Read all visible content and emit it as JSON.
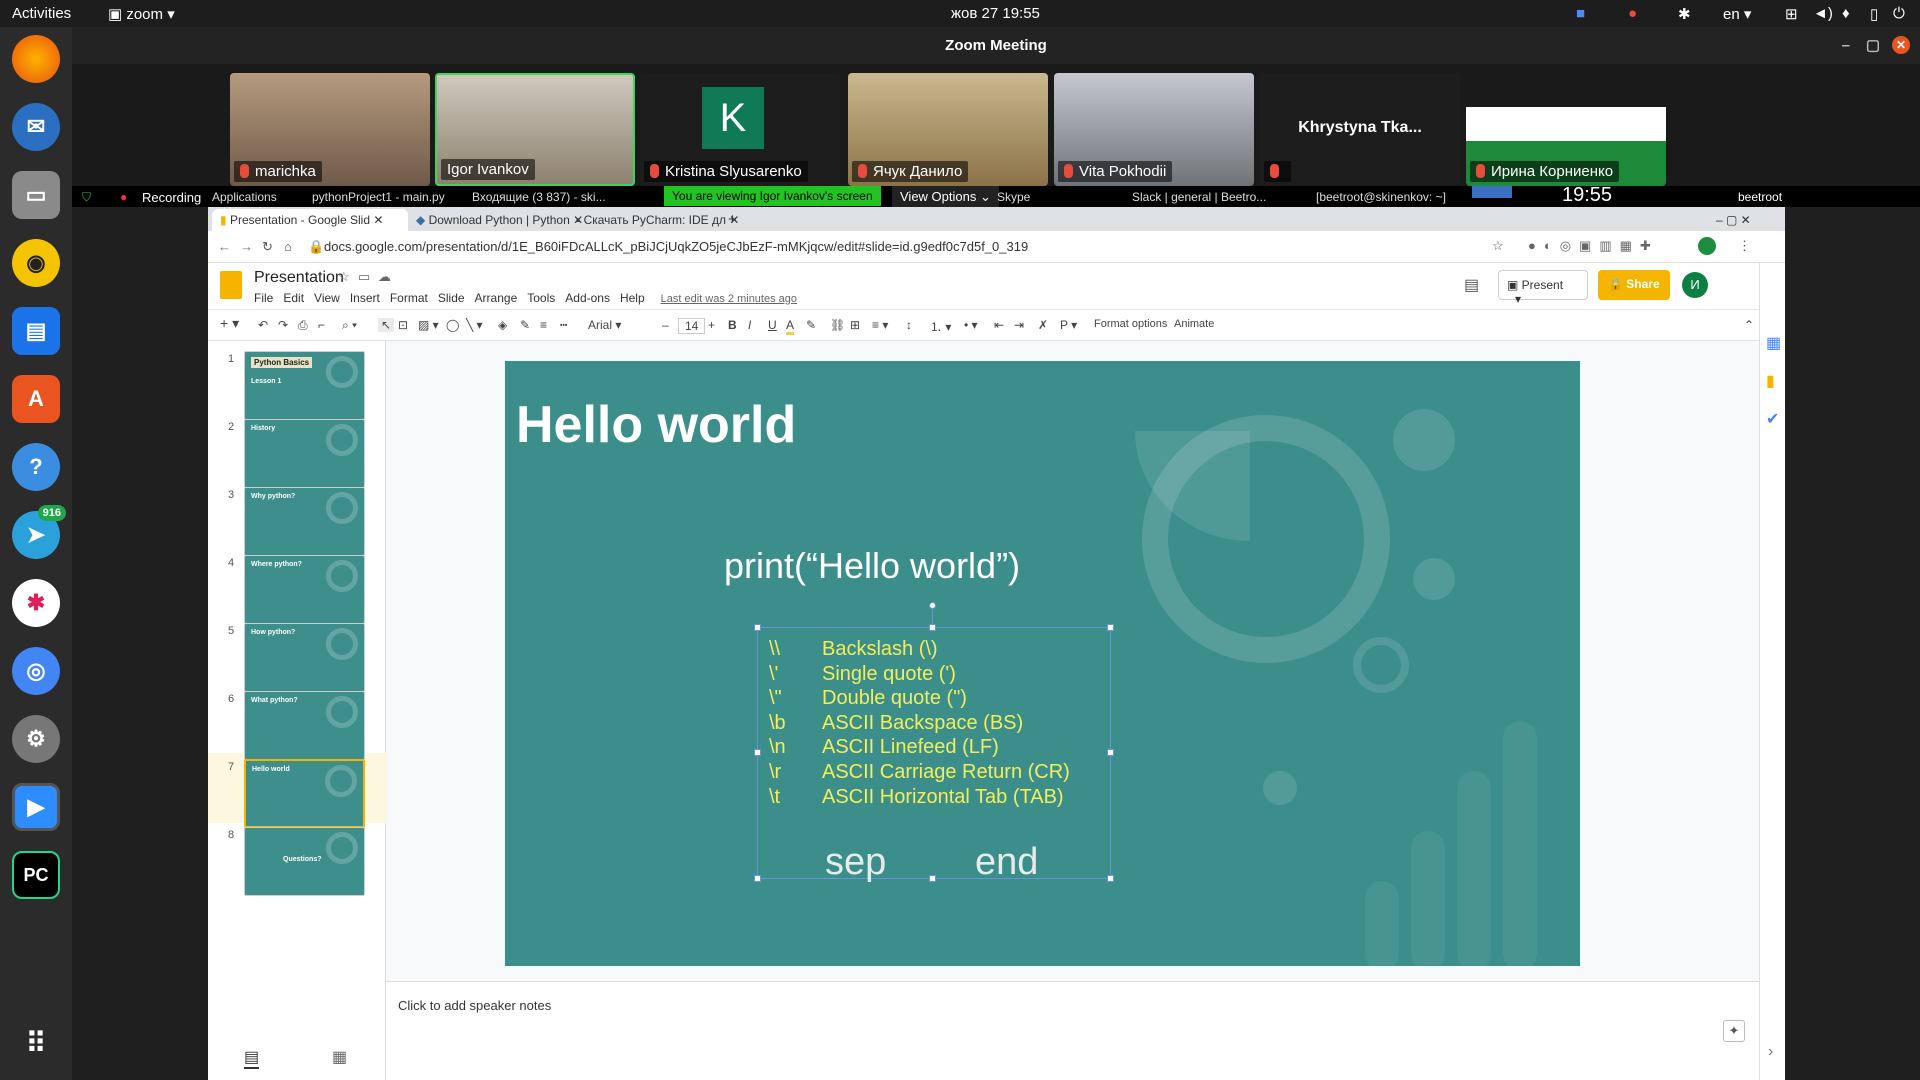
{
  "topbar": {
    "activities": "Activities",
    "app": "zoom",
    "datetime": "жов 27  19:55",
    "lang": "en"
  },
  "dock": {
    "telegram_badge": "916"
  },
  "zoom": {
    "title": "Zoom Meeting",
    "participants": [
      {
        "name": "marichka"
      },
      {
        "name": "Igor Ivankov"
      },
      {
        "name": "Kristina Slyusarenko",
        "initial": "K"
      },
      {
        "name": "Ячук Данило"
      },
      {
        "name": "Vita Pokhodii"
      },
      {
        "name": "Khrystyna Tka..."
      },
      {
        "name": "Ирина Корниенко"
      }
    ]
  },
  "share": {
    "recording": "Recording",
    "applications": "Applications",
    "win_pycharm": "pythonProject1 - main.py",
    "win_gmail": "Входящие (3 837) - ski...",
    "banner": "You are viewing Igor Ivankov's screen",
    "view_options": "View Options",
    "win_skype": "Skype",
    "win_slack": "Slack | general | Beetro...",
    "win_terminal": "[beetroot@skinenkov: ~]",
    "clock": "19:55",
    "user": "beetroot"
  },
  "browser": {
    "tabs": [
      "Presentation - Google Slid",
      "Download Python | Python",
      "Скачать PyCharm: IDE дл"
    ],
    "url": "docs.google.com/presentation/d/1E_B60iFDcALLcK_pBiJCjUqkZO5jeCJbEzF-mMKjqcw/edit#slide=id.g9edf0c7d5f_0_319"
  },
  "doc": {
    "title": "Presentation",
    "menus": [
      "File",
      "Edit",
      "View",
      "Insert",
      "Format",
      "Slide",
      "Arrange",
      "Tools",
      "Add-ons",
      "Help"
    ],
    "last_edit": "Last edit was 2 minutes ago",
    "present": "Present",
    "share": "Share",
    "avatar": "И"
  },
  "toolbar": {
    "font": "Arial",
    "size": "14",
    "format_options": "Format options",
    "animate": "Animate"
  },
  "filmstrip": {
    "numbers": [
      "1",
      "2",
      "3",
      "4",
      "5",
      "6",
      "7",
      "8"
    ],
    "thumb_titles": [
      "Python Basics",
      "History",
      "Why python?",
      "Where python?",
      "How python?",
      "What python?",
      "Hello world",
      "Questions?"
    ],
    "thumb1_sub": "Lesson 1"
  },
  "slide": {
    "title": "Hello world",
    "code": "print(“Hello world”)",
    "escapes": [
      {
        "seq": "\\\\",
        "desc": "Backslash (\\)"
      },
      {
        "seq": "\\'",
        "desc": "Single quote (')"
      },
      {
        "seq": "\\\"",
        "desc": "Double quote (\")"
      },
      {
        "seq": "\\b",
        "desc": "ASCII Backspace (BS)"
      },
      {
        "seq": "\\n",
        "desc": "ASCII Linefeed (LF)"
      },
      {
        "seq": "\\r",
        "desc": "ASCII Carriage Return (CR)"
      },
      {
        "seq": "\\t",
        "desc": "ASCII Horizontal Tab (TAB)"
      }
    ],
    "sep": "sep",
    "end": "end"
  },
  "notes": {
    "placeholder": "Click to add speaker notes"
  }
}
